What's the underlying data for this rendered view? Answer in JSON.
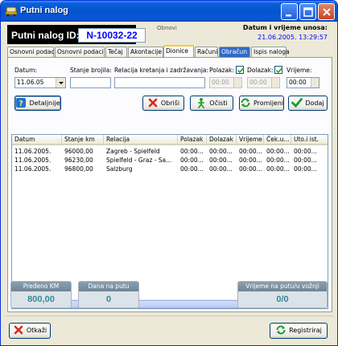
{
  "window": {
    "title": "Putni nalog"
  },
  "header": {
    "id_label": "Putni nalog ID:",
    "id_value": "N-10032-22",
    "refresh": "Obnovi",
    "datetime_label": "Datum i vrijeme unosa:",
    "datetime_value": "21.06.2005. 13:29:57"
  },
  "tabs": [
    {
      "label": "Osnovni podaci I",
      "active": false
    },
    {
      "label": "Osnovni podaci II",
      "active": false
    },
    {
      "label": "Tečaj",
      "active": false
    },
    {
      "label": "Akontacije",
      "active": false
    },
    {
      "label": "Dionice",
      "active": true
    },
    {
      "label": "Računi",
      "active": false
    },
    {
      "label": "Obračun",
      "active": false,
      "highlighted": true
    },
    {
      "label": "Ispis naloga",
      "active": false
    }
  ],
  "form": {
    "datum_label": "Datum:",
    "datum_value": "11.06.05",
    "stanje_label": "Stanje brojila:",
    "stanje_value": "",
    "relacija_label": "Relacija kretanja i zadržavanja:",
    "relacija_value": "",
    "polazak_label": "Polazak:",
    "polazak_checked": true,
    "polazak_value": "00:00",
    "dolazak_label": "Dolazak:",
    "dolazak_checked": true,
    "dolazak_value": "00:00",
    "vrijeme_label": "Vrijeme:",
    "vrijeme_value": "00:00"
  },
  "buttons": {
    "details": "Detaljnije",
    "delete": "Obriši",
    "clear": "Očisti",
    "change": "Promijeni",
    "add": "Dodaj",
    "cancel": "Otkaži",
    "register": "Registriraj"
  },
  "table": {
    "columns": [
      "Datum",
      "Stanje km",
      "Relacija",
      "Polazak",
      "Dolazak",
      "Vrijeme",
      "Ček.u...",
      "Uto.i ist."
    ],
    "rows": [
      [
        "11.06.2005.",
        "96000,00",
        "Zagreb - Spielfeld",
        "00:00...",
        "00:00...",
        "00:00...",
        "00:00...",
        "00:00..."
      ],
      [
        "11.06.2005.",
        "96230,00",
        "Spielfeld - Graz - Sa...",
        "00:00...",
        "00:00...",
        "00:00...",
        "00:00...",
        "00:00..."
      ],
      [
        "11.06.2005.",
        "96800,00",
        "Salzburg",
        "00:00...",
        "00:00...",
        "00:00...",
        "00:00...",
        "00:00..."
      ]
    ]
  },
  "stats": {
    "km_label": "Pređeno KM",
    "km_value": "800,00",
    "days_label": "Dana na putu",
    "days_value": "0",
    "time_label": "Vrijeme na putu/u vožnji",
    "time_value": "0/0"
  },
  "colors": {
    "titlebar": "#0453cf",
    "id_value_text": "#0000ff",
    "stat_value": "#2f8a9a",
    "tab_highlight": "#316ac5"
  }
}
